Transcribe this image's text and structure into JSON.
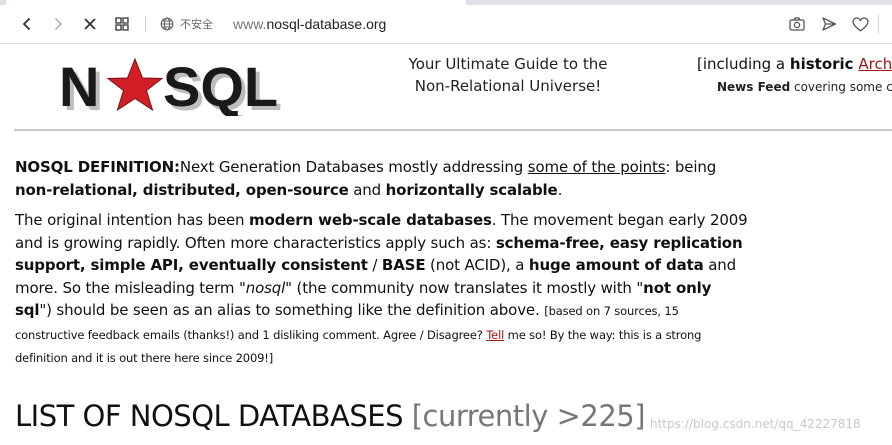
{
  "browser": {
    "security_label": "不安全",
    "url_prefix": "www.",
    "url_domain": "nosql-database.org"
  },
  "header": {
    "logo_text_left": "N",
    "logo_text_right": "SQL",
    "tagline_line1": "Your Ultimate Guide to the",
    "tagline_line2": "Non-Relational Universe!",
    "archive_prefix": "[including a ",
    "archive_bold": "historic",
    "archive_link": "Archive",
    "newsfeed_bold": "News Feed",
    "newsfeed_rest": " covering some cha"
  },
  "definition": {
    "label": "NOSQL DEFINITION:",
    "t1": "Next Generation Databases mostly addressing ",
    "link": "some of the points",
    "t2": ": being ",
    "b1": "non-relational, distributed, open-source",
    "t3": " and ",
    "b2": "horizontally scalable",
    "t4": "."
  },
  "intention": {
    "t1": "The original intention has been ",
    "b1": "modern web-scale databases",
    "t2": ". The movement began early 2009 and is growing rapidly. Often more characteristics apply such as: ",
    "b2": "schema-free, easy replication support, simple API, eventually consistent",
    "t3": " / ",
    "b3": "BASE",
    "t4": " (not ACID), a ",
    "b4": "huge amount of data",
    "t5": " and more. So the misleading term ",
    "i1": "\"nosql\"",
    "t6": " (the community now translates it mostly with \"",
    "b5": "not only sql",
    "t7": "\") should be seen as an alias to something like the definition above. ",
    "small1": "[based on 7 sources, 15 constructive feedback emails (thanks!) and 1 disliking comment. Agree / Disagree? ",
    "small_link": "Tell",
    "small2": " me so! By the way: this is a strong definition and it is out there here since 2009!]"
  },
  "list_heading": {
    "main": "LIST OF NOSQL DATABASES",
    "count": "[currently >225]"
  },
  "watermark": "https://blog.csdn.net/qq_42227818"
}
